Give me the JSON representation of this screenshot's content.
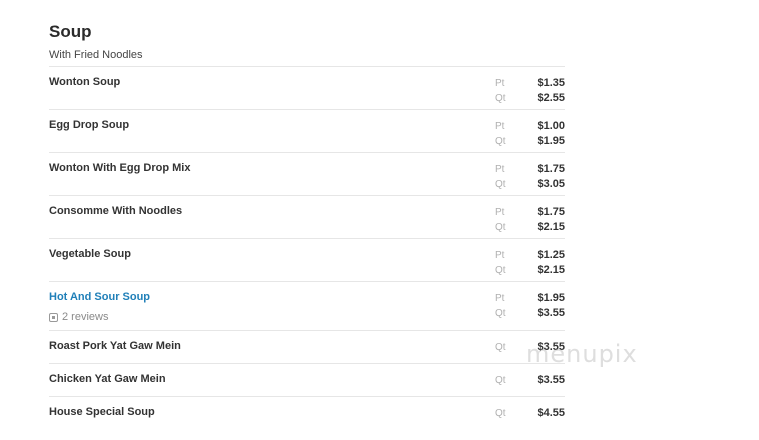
{
  "section": {
    "title": "Soup",
    "subtitle": "With Fried Noodles"
  },
  "items": [
    {
      "name": "Wonton Soup",
      "prices": [
        {
          "size": "Pt",
          "price": "$1.35"
        },
        {
          "size": "Qt",
          "price": "$2.55"
        }
      ]
    },
    {
      "name": "Egg Drop Soup",
      "prices": [
        {
          "size": "Pt",
          "price": "$1.00"
        },
        {
          "size": "Qt",
          "price": "$1.95"
        }
      ]
    },
    {
      "name": "Wonton With Egg Drop Mix",
      "prices": [
        {
          "size": "Pt",
          "price": "$1.75"
        },
        {
          "size": "Qt",
          "price": "$3.05"
        }
      ]
    },
    {
      "name": "Consomme With Noodles",
      "prices": [
        {
          "size": "Pt",
          "price": "$1.75"
        },
        {
          "size": "Qt",
          "price": "$2.15"
        }
      ]
    },
    {
      "name": "Vegetable Soup",
      "prices": [
        {
          "size": "Pt",
          "price": "$1.25"
        },
        {
          "size": "Qt",
          "price": "$2.15"
        }
      ]
    },
    {
      "name": "Hot And Sour Soup",
      "reviews": "2 reviews",
      "prices": [
        {
          "size": "Pt",
          "price": "$1.95"
        },
        {
          "size": "Qt",
          "price": "$3.55"
        }
      ]
    },
    {
      "name": "Roast Pork Yat Gaw Mein",
      "prices": [
        {
          "size": "Qt",
          "price": "$3.55"
        }
      ]
    },
    {
      "name": "Chicken Yat Gaw Mein",
      "prices": [
        {
          "size": "Qt",
          "price": "$3.55"
        }
      ]
    },
    {
      "name": "House Special Soup",
      "prices": [
        {
          "size": "Qt",
          "price": "$4.55"
        }
      ]
    }
  ],
  "watermark": "menupix",
  "colors": {
    "link": "#1f7fb8",
    "divider": "#e6e6e6"
  }
}
